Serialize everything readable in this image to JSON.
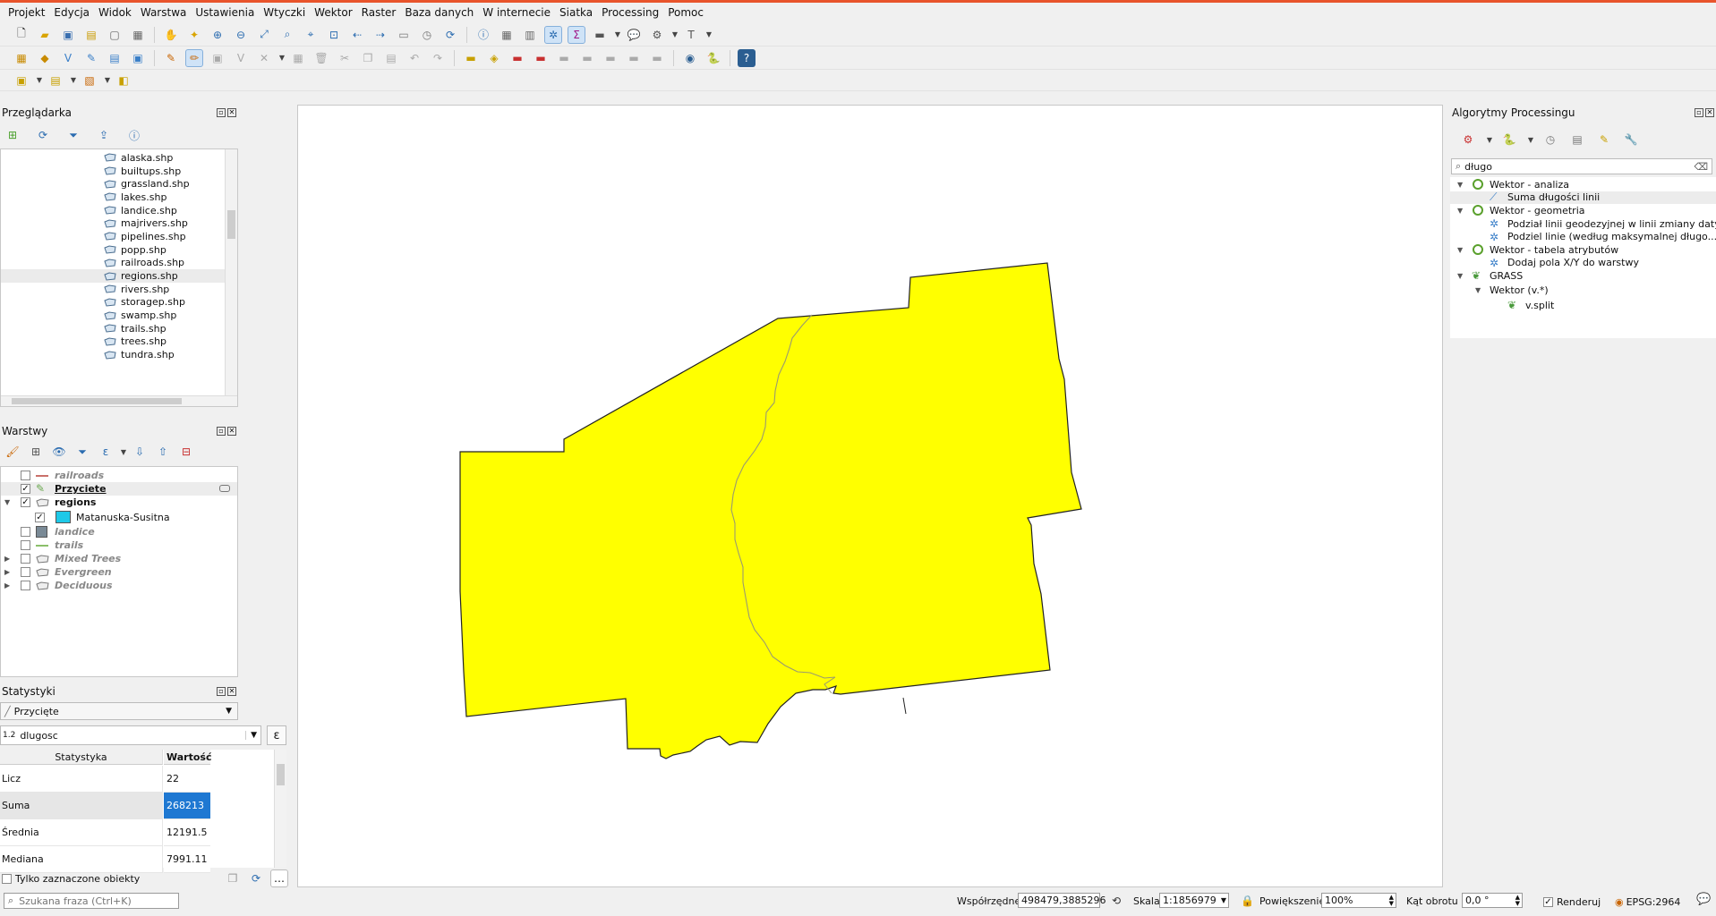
{
  "menu": [
    "Projekt",
    "Edycja",
    "Widok",
    "Warstwa",
    "Ustawienia",
    "Wtyczki",
    "Wektor",
    "Raster",
    "Baza danych",
    "W internecie",
    "Siatka",
    "Processing",
    "Pomoc"
  ],
  "browser": {
    "title": "Przeglądarka",
    "items": [
      "alaska.shp",
      "builtups.shp",
      "grassland.shp",
      "lakes.shp",
      "landice.shp",
      "majrivers.shp",
      "pipelines.shp",
      "popp.shp",
      "railroads.shp",
      "regions.shp",
      "rivers.shp",
      "storagep.shp",
      "swamp.shp",
      "trails.shp",
      "trees.shp",
      "tundra.shp"
    ],
    "selected": "regions.shp"
  },
  "layers": {
    "title": "Warstwy",
    "items": [
      {
        "name": "railroads",
        "style": "italic",
        "checked": false,
        "symbol": "line",
        "color": "#c9706a"
      },
      {
        "name": "Przyciete",
        "style": "bold-underline",
        "checked": true,
        "symbol": "edit",
        "color": "#6aa84f"
      },
      {
        "name": "regions",
        "style": "bold",
        "checked": true,
        "symbol": "polygon",
        "expanded": true
      },
      {
        "name": "Matanuska-Susitna",
        "style": "normal",
        "checked": true,
        "symbol": "fill",
        "color": "#1ec9e8",
        "child": true
      },
      {
        "name": "landice",
        "style": "italic",
        "checked": false,
        "symbol": "fill",
        "color": "#7a8a96"
      },
      {
        "name": "trails",
        "style": "italic",
        "checked": false,
        "symbol": "line",
        "color": "#8bbf6a"
      },
      {
        "name": "Mixed Trees",
        "style": "italic",
        "checked": false,
        "symbol": "polygon",
        "collapsed": true
      },
      {
        "name": "Evergreen",
        "style": "italic",
        "checked": false,
        "symbol": "polygon",
        "collapsed": true
      },
      {
        "name": "Deciduous",
        "style": "italic",
        "checked": false,
        "symbol": "polygon",
        "collapsed": true
      }
    ]
  },
  "stats": {
    "title": "Statystyki",
    "layer": "Przycięte",
    "field_prefix": "1.2",
    "field": "dlugosc",
    "col_stat": "Statystyka",
    "col_value": "Wartość",
    "rows": [
      {
        "label": "Licz",
        "value": "22"
      },
      {
        "label": "Suma",
        "value": "268213",
        "selected": true
      },
      {
        "label": "Średnia",
        "value": "12191.5"
      },
      {
        "label": "Mediana",
        "value": "7991.11"
      }
    ],
    "only_selected": "Tylko zaznaczone obiekty"
  },
  "processing": {
    "title": "Algorytmy Processingu",
    "search": "długo",
    "tree": [
      {
        "type": "group",
        "label": "Wektor - analiza",
        "icon": "qgis-icon"
      },
      {
        "type": "alg",
        "label": "Suma długości linii",
        "icon": "line-length-icon",
        "selected": true
      },
      {
        "type": "group",
        "label": "Wektor - geometria",
        "icon": "qgis-icon"
      },
      {
        "type": "alg",
        "label": "Podział linii geodezyjnej w linii zmiany daty",
        "icon": "gear-icon"
      },
      {
        "type": "alg",
        "label": "Podziel linie (według maksymalnej długo...",
        "icon": "gear-icon"
      },
      {
        "type": "group",
        "label": "Wektor - tabela atrybutów",
        "icon": "qgis-icon"
      },
      {
        "type": "alg",
        "label": "Dodaj pola X/Y do warstwy",
        "icon": "gear-icon"
      },
      {
        "type": "group",
        "label": "GRASS",
        "icon": "grass-icon"
      },
      {
        "type": "subgroup",
        "label": "Wektor (v.*)"
      },
      {
        "type": "subalg",
        "label": "v.split",
        "icon": "grass-icon"
      }
    ]
  },
  "locator": {
    "placeholder": "Szukana fraza (Ctrl+K)"
  },
  "status": {
    "coord_label": "Współrzędne",
    "coord_value": "498479,3885296",
    "scale_label": "Skala",
    "scale_value": "1:1856979",
    "magnifier_label": "Powiększenie",
    "magnifier_value": "100%",
    "rotation_label": "Kąt obrotu",
    "rotation_value": "0,0 °",
    "render_label": "Renderuj",
    "crs": "EPSG:2964"
  },
  "colors": {
    "map_fill": "#ffff00",
    "accent": "#e8542c",
    "selection": "#1e78d2"
  }
}
